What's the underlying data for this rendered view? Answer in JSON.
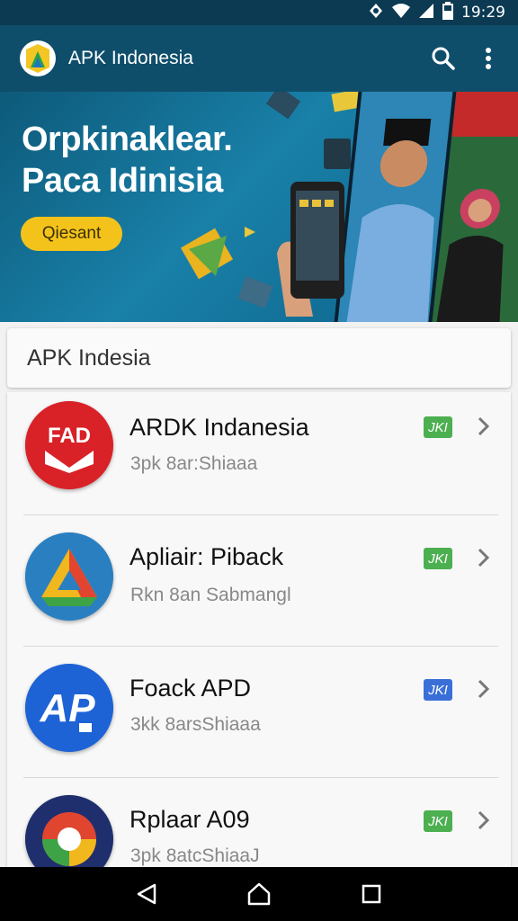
{
  "status_bar": {
    "time": "19:29"
  },
  "app_bar": {
    "title": "APK Indonesia"
  },
  "banner": {
    "title_line1": "Orpkinaklear.",
    "title_line2": "Paca Idinisia",
    "button_label": "Qiesant"
  },
  "search": {
    "value": "APK Indesia"
  },
  "apps": [
    {
      "name": "ARDK Indanesia",
      "subtitle": "3pk 8ar:Shiaaa",
      "badge": "JKI",
      "badge_color": "#4caf50",
      "icon": "fap-icon"
    },
    {
      "name": "Apliair: Piback",
      "subtitle": "Rkn 8an Sabmangl",
      "badge": "JKI",
      "badge_color": "#4caf50",
      "icon": "triangle-logo-icon"
    },
    {
      "name": "Foack APD",
      "subtitle": "3kk 8arsShiaaa",
      "badge": "JKI",
      "badge_color": "#3a6fd8",
      "icon": "ap-logo-icon"
    },
    {
      "name": "Rplaar A09",
      "subtitle": "3pk 8atcShiaaJ",
      "badge": "JKI",
      "badge_color": "#4caf50",
      "icon": "chrome-like-icon"
    }
  ],
  "colors": {
    "app_bar": "#0f4e6b",
    "accent": "#f4c31b"
  }
}
